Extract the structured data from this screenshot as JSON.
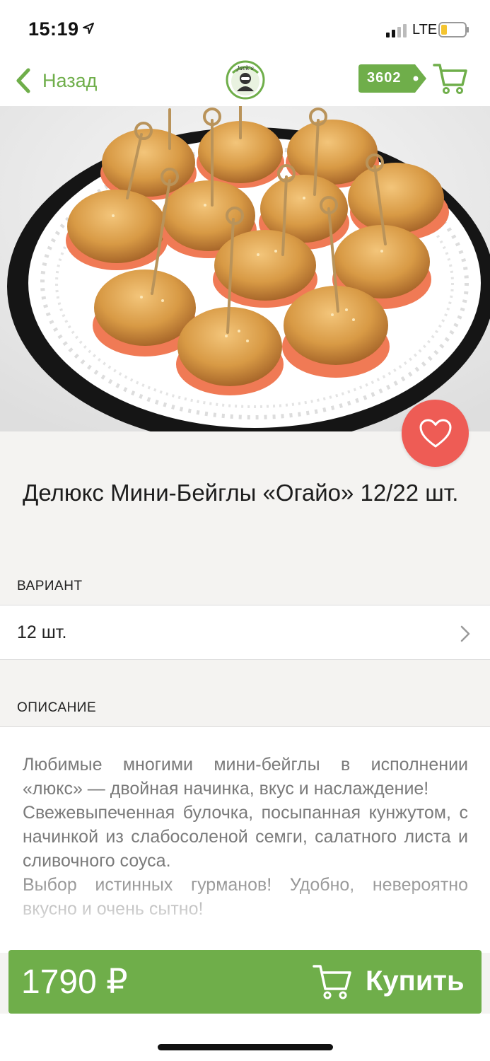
{
  "status": {
    "time": "15:19",
    "network": "LTE"
  },
  "nav": {
    "back_label": "Назад",
    "points": "3602",
    "logo_alt": "Jack's"
  },
  "product": {
    "title": "Делюкс Мини-Бейглы «Огайо» 12/22 шт.",
    "image_alt": "Мини-бейглы с семгой"
  },
  "variant": {
    "header": "ВАРИАНТ",
    "value": "12 шт."
  },
  "description": {
    "header": "ОПИСАНИЕ",
    "text": "Любимые многими мини-бейглы в исполнении «люкс» — двойная начинка, вкус и наслаждение!\nСвежевыпеченная булочка, посыпанная кунжутом, с начинкой из слабосоленой семги, салатного листа  и сливочного соуса.\nВыбор истинных гурманов! Удобно, невероятно вкусно и очень сытно!"
  },
  "buy": {
    "price": "1790 ₽",
    "label": "Купить"
  },
  "colors": {
    "accent_green": "#6fae4a",
    "favorite_red": "#ee5c55",
    "background": "#f4f3f1"
  },
  "icons": {
    "back": "chevron-left-icon",
    "cart": "cart-icon",
    "favorite": "heart-icon",
    "variant_arrow": "chevron-right-icon",
    "location": "location-arrow-icon"
  }
}
